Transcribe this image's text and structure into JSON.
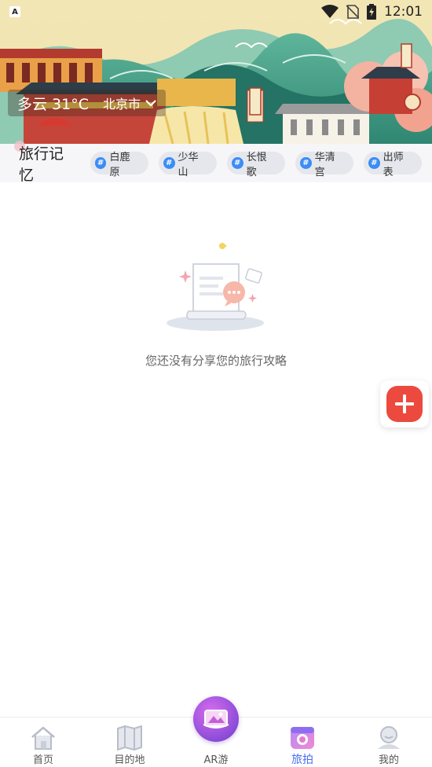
{
  "status_bar": {
    "left_icon_text": "A",
    "time": "12:01"
  },
  "weather": {
    "condition_temp": "多云 31°C",
    "city": "北京市"
  },
  "tags_section": {
    "title": "旅行记忆",
    "tags": [
      {
        "label": "白鹿原"
      },
      {
        "label": "少华山"
      },
      {
        "label": "长恨歌"
      },
      {
        "label": "华清宫"
      },
      {
        "label": "出师表"
      }
    ],
    "hash_symbol": "#"
  },
  "empty_state": {
    "message": "您还没有分享您的旅行攻略"
  },
  "bottom_nav": {
    "items": [
      {
        "label": "首页",
        "icon": "home-icon"
      },
      {
        "label": "目的地",
        "icon": "map-icon"
      },
      {
        "label": "AR游",
        "icon": "ar-icon"
      },
      {
        "label": "旅拍",
        "icon": "camera-icon",
        "active": true
      },
      {
        "label": "我的",
        "icon": "profile-icon"
      }
    ]
  },
  "colors": {
    "accent_blue": "#4b6ef0",
    "fab_red": "#ec4a3e",
    "tag_hash_blue": "#3b8cf5"
  }
}
